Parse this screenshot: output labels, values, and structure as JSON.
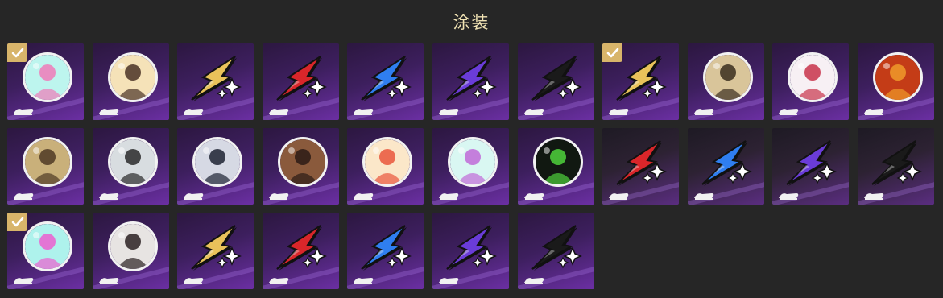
{
  "title": "涂装",
  "items": [
    {
      "icon": "spray-art-medal-icon",
      "equipped": true,
      "kind": "medal",
      "colors": [
        "#bdf5ee",
        "#f07ab8"
      ]
    },
    {
      "icon": "character-portrait-medal-icon",
      "equipped": false,
      "kind": "medal",
      "colors": [
        "#f5e2b8",
        "#4a3326"
      ]
    },
    {
      "icon": "gold-star-spray-icon",
      "equipped": false,
      "kind": "star",
      "colors": [
        "#e9c25a"
      ]
    },
    {
      "icon": "red-star-spray-icon",
      "equipped": false,
      "kind": "star",
      "colors": [
        "#d9262a"
      ]
    },
    {
      "icon": "blue-star-spray-icon",
      "equipped": false,
      "kind": "star",
      "colors": [
        "#2f7ef0"
      ]
    },
    {
      "icon": "purple-star-spray-icon",
      "equipped": false,
      "kind": "star",
      "colors": [
        "#6a3cd8"
      ]
    },
    {
      "icon": "black-star-spray-icon",
      "equipped": false,
      "kind": "star",
      "colors": [
        "#1a1a1a"
      ]
    },
    {
      "icon": "gold-star-spray-icon",
      "equipped": true,
      "kind": "star",
      "colors": [
        "#e9c25a"
      ]
    },
    {
      "icon": "emblem-logo-medal-icon",
      "equipped": false,
      "kind": "medal",
      "colors": [
        "#d9c59a",
        "#3a2e1f"
      ]
    },
    {
      "icon": "anime-girl-medal-icon",
      "equipped": false,
      "kind": "medal",
      "colors": [
        "#f7f0f4",
        "#c8334a"
      ]
    },
    {
      "icon": "red-creature-medal-icon",
      "equipped": false,
      "kind": "medal",
      "colors": [
        "#c43c17",
        "#f09a2a"
      ]
    },
    {
      "icon": "warrior-portrait-medal-icon",
      "equipped": false,
      "kind": "medal",
      "colors": [
        "#c9b07a",
        "#4f3a25"
      ]
    },
    {
      "icon": "skull-mask-medal-icon",
      "equipped": false,
      "kind": "medal",
      "colors": [
        "#d8dde0",
        "#2a2a2a"
      ]
    },
    {
      "icon": "dark-hair-character-medal-icon",
      "equipped": false,
      "kind": "medal",
      "colors": [
        "#d6d9e4",
        "#1d2233"
      ]
    },
    {
      "icon": "two-characters-medal-icon",
      "equipped": false,
      "kind": "medal",
      "colors": [
        "#8a5a3c",
        "#2b1b15"
      ]
    },
    {
      "icon": "cute-creatures-medal-icon",
      "equipped": false,
      "kind": "medal",
      "colors": [
        "#fbe7c9",
        "#e9563c"
      ]
    },
    {
      "icon": "planet-doodle-medal-icon",
      "equipped": false,
      "kind": "medal",
      "colors": [
        "#d9f7f2",
        "#c06ad8"
      ]
    },
    {
      "icon": "green-flame-medal-icon",
      "equipped": false,
      "kind": "medal",
      "colors": [
        "#111811",
        "#4fd23c"
      ]
    },
    {
      "icon": "red-star-spray-icon",
      "equipped": false,
      "kind": "star",
      "colors": [
        "#d9262a"
      ],
      "dark": true
    },
    {
      "icon": "blue-star-spray-icon",
      "equipped": false,
      "kind": "star",
      "colors": [
        "#2f7ef0"
      ],
      "dark": true
    },
    {
      "icon": "purple-star-spray-icon",
      "equipped": false,
      "kind": "star",
      "colors": [
        "#6a3cd8"
      ],
      "dark": true
    },
    {
      "icon": "black-star-spray-icon",
      "equipped": false,
      "kind": "star",
      "colors": [
        "#1a1a1a"
      ],
      "dark": true
    },
    {
      "icon": "pink-cat-medal-icon",
      "equipped": true,
      "kind": "medal",
      "colors": [
        "#aef2ec",
        "#ec5fd0"
      ]
    },
    {
      "icon": "dark-haired-girl-medal-icon",
      "equipped": false,
      "kind": "medal",
      "colors": [
        "#e7e4e2",
        "#2a2122"
      ]
    },
    {
      "icon": "gold-star-spray-icon",
      "equipped": false,
      "kind": "star",
      "colors": [
        "#e9c25a"
      ]
    },
    {
      "icon": "red-star-spray-icon",
      "equipped": false,
      "kind": "star",
      "colors": [
        "#d9262a"
      ]
    },
    {
      "icon": "blue-star-spray-icon",
      "equipped": false,
      "kind": "star",
      "colors": [
        "#2f7ef0"
      ]
    },
    {
      "icon": "purple-star-spray-icon",
      "equipped": false,
      "kind": "star",
      "colors": [
        "#6a3cd8"
      ]
    },
    {
      "icon": "black-star-spray-icon",
      "equipped": false,
      "kind": "star",
      "colors": [
        "#1a1a1a"
      ]
    }
  ]
}
